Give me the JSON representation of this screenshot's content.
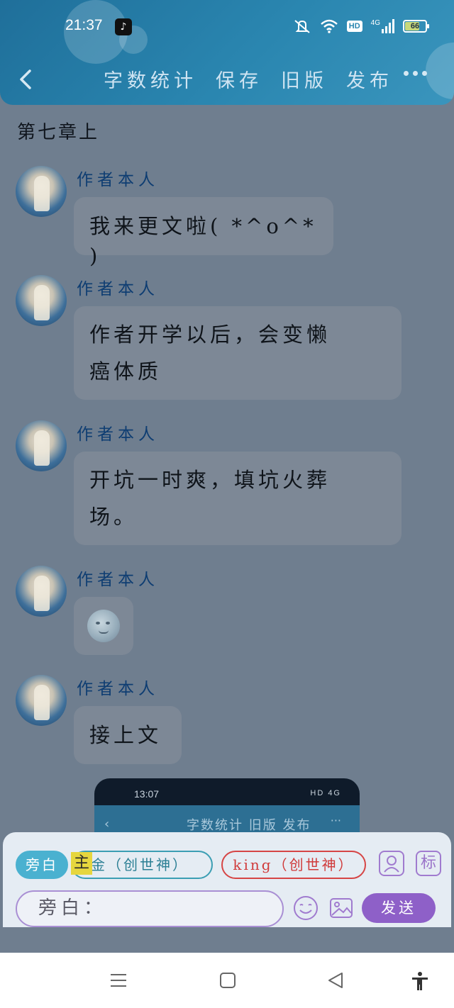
{
  "status_bar": {
    "time": "21:37",
    "app_icon": "tiktok-icon",
    "icons": [
      "mute-icon",
      "wifi-icon",
      "hd-icon",
      "signal-4g-icon",
      "battery-icon"
    ],
    "hd_label": "HD",
    "network": "4G",
    "battery": "66"
  },
  "nav": {
    "back_icon": "chevron-left-icon",
    "items": [
      "字数统计",
      "保存",
      "旧版",
      "发布"
    ],
    "more_icon": "more-dots-icon"
  },
  "chapter_title": "第七章上",
  "messages": [
    {
      "sender": "作者本人",
      "text": "我来更文啦( *^o^* )"
    },
    {
      "sender": "作者本人",
      "text_lines": [
        "作者开学以后，会变懒",
        "癌体质"
      ]
    },
    {
      "sender": "作者本人",
      "text_lines": [
        "开坑一时爽，填坑火葬",
        "场。"
      ]
    },
    {
      "sender": "作者本人",
      "emoji": "moon-face-icon"
    },
    {
      "sender": "作者本人",
      "text": "接上文"
    }
  ],
  "embedded_screenshot": {
    "time": "13:07",
    "status": "HD 4G",
    "nav_text": "字数统计 旧版 发布",
    "back": "‹",
    "more": "···"
  },
  "input_panel": {
    "roles": [
      "旁白",
      "金（创世神）",
      "king（创世神）"
    ],
    "highlight_char": "主",
    "tag_label": "标",
    "input_placeholder": "旁白：",
    "send_label": "发送",
    "icons": [
      "user-card-icon",
      "emoji-icon",
      "image-icon"
    ]
  },
  "system_nav": {
    "icons": [
      "menu-icon",
      "home-square-icon",
      "back-triangle-icon",
      "accessibility-icon"
    ]
  },
  "colors": {
    "header": "#2a86b0",
    "overlay": "#6f7e8f",
    "send_button": "#8e60c8",
    "aside_button": "#4ab1d0",
    "king_border": "#d64545"
  }
}
